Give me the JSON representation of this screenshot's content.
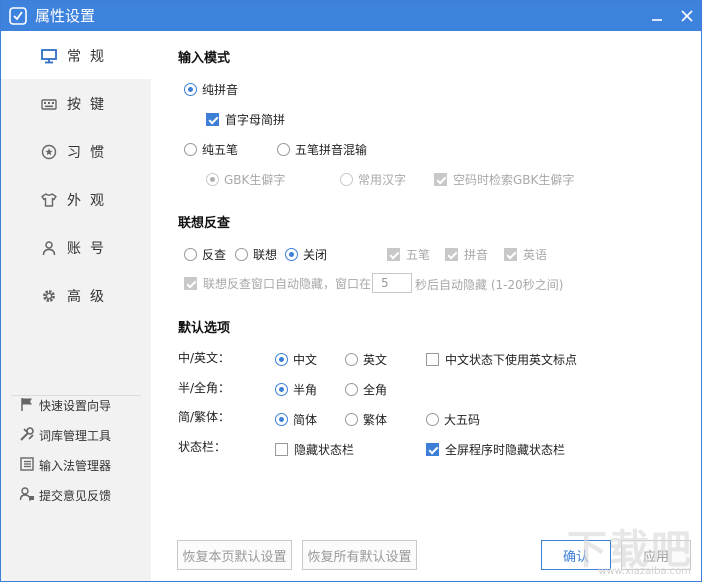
{
  "window": {
    "title": "属性设置"
  },
  "sidebar": {
    "items": [
      {
        "label": "常规",
        "icon": "monitor-icon",
        "active": true
      },
      {
        "label": "按键",
        "icon": "keyboard-icon",
        "active": false
      },
      {
        "label": "习惯",
        "icon": "star-circle-icon",
        "active": false
      },
      {
        "label": "外观",
        "icon": "shirt-icon",
        "active": false
      },
      {
        "label": "账号",
        "icon": "user-icon",
        "active": false
      },
      {
        "label": "高级",
        "icon": "gear-icon",
        "active": false
      }
    ],
    "tools": [
      {
        "label": "快速设置向导",
        "icon": "flag-icon"
      },
      {
        "label": "词库管理工具",
        "icon": "tools-icon"
      },
      {
        "label": "输入法管理器",
        "icon": "list-icon"
      },
      {
        "label": "提交意见反馈",
        "icon": "feedback-icon"
      }
    ]
  },
  "input_mode": {
    "title": "输入模式",
    "pinyin": "纯拼音",
    "initials": "首字母简拼",
    "wubi": "纯五笔",
    "mixed": "五笔拼音混输",
    "gbk_rare": "GBK生僻字",
    "common_hanzi": "常用汉字",
    "search_gbk": "空码时检索GBK生僻字"
  },
  "assoc": {
    "title": "联想反查",
    "lookup": "反查",
    "assoc": "联想",
    "off": "关闭",
    "wubi": "五笔",
    "pinyin": "拼音",
    "english": "英语",
    "autohide_prefix": "联想反查窗口自动隐藏，窗口在",
    "seconds": "5",
    "autohide_suffix": "秒后自动隐藏 (1-20秒之间)"
  },
  "defaults": {
    "title": "默认选项",
    "cn_en_label": "中/英文：",
    "cn": "中文",
    "en": "英文",
    "en_punct": "中文状态下使用英文标点",
    "width_label": "半/全角：",
    "half": "半角",
    "full": "全角",
    "script_label": "简/繁体：",
    "simp": "简体",
    "trad": "繁体",
    "big5": "大五码",
    "status_label": "状态栏：",
    "hide_status": "隐藏状态栏",
    "hide_fullscreen": "全屏程序时隐藏状态栏"
  },
  "buttons": {
    "restore_page": "恢复本页默认设置",
    "restore_all": "恢复所有默认设置",
    "ok": "确认",
    "apply": "应用"
  },
  "watermark": {
    "text": "下载吧",
    "url": "www.xiazaiba.com"
  },
  "colors": {
    "title_bar": "#3d82dc",
    "accent": "#3d7fd6",
    "sidebar_bg": "#f2f2f2"
  }
}
